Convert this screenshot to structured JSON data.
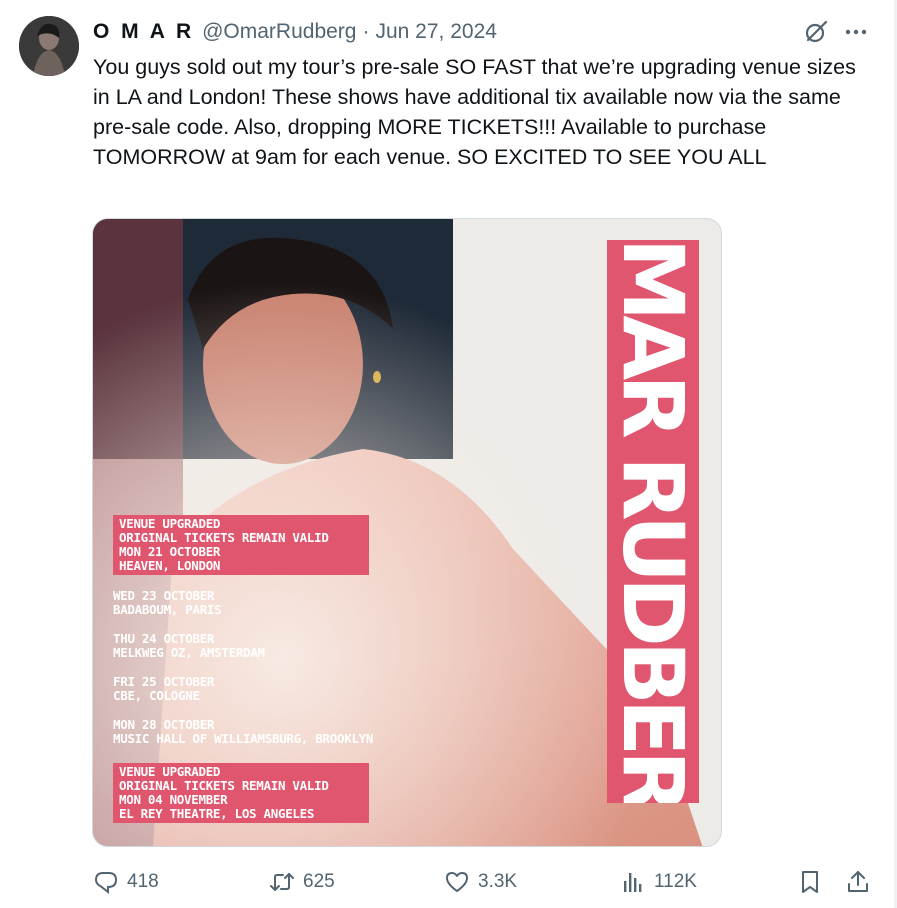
{
  "tweet": {
    "author_name": "O M A R",
    "handle": "@OmarRudberg",
    "separator": "·",
    "date": "Jun 27, 2024",
    "text": "You guys sold out my tour’s pre-sale SO FAST that we’re upgrading venue sizes in LA and London! These shows have additional tix available now via the same pre-sale code. Also, dropping MORE TICKETS!!! Available to purchase TOMORROW at 9am for each venue. SO EXCITED TO SEE YOU ALL"
  },
  "poster": {
    "artist_name": "OMAR RUDBERG",
    "events": [
      {
        "lines": [
          "VENUE UPGRADED",
          "ORIGINAL TICKETS REMAIN VALID",
          "MON 21 OCTOBER",
          "HEAVEN, LONDON"
        ],
        "highlight": true
      },
      {
        "lines": [
          "WED 23 OCTOBER",
          "BADABOUM, PARIS"
        ],
        "highlight": false
      },
      {
        "lines": [
          "THU 24 OCTOBER",
          "MELKWEG OZ, AMSTERDAM"
        ],
        "highlight": false
      },
      {
        "lines": [
          "FRI 25 OCTOBER",
          "CBE, COLOGNE"
        ],
        "highlight": false
      },
      {
        "lines": [
          "MON 28 OCTOBER",
          "MUSIC HALL OF WILLIAMSBURG, BROOKLYN"
        ],
        "highlight": false
      },
      {
        "lines": [
          "VENUE UPGRADED",
          "ORIGINAL TICKETS REMAIN VALID",
          "MON 04 NOVEMBER",
          "EL REY THEATRE, LOS ANGELES"
        ],
        "highlight": true
      }
    ]
  },
  "actions": {
    "replies": "418",
    "reposts": "625",
    "likes": "3.3K",
    "views": "112K"
  },
  "icons": [
    "grok-icon",
    "more-icon",
    "reply-icon",
    "repost-icon",
    "like-icon",
    "views-icon",
    "bookmark-icon",
    "share-icon"
  ],
  "colors": {
    "accent_pink": "#e0566e",
    "muted": "#536471"
  }
}
